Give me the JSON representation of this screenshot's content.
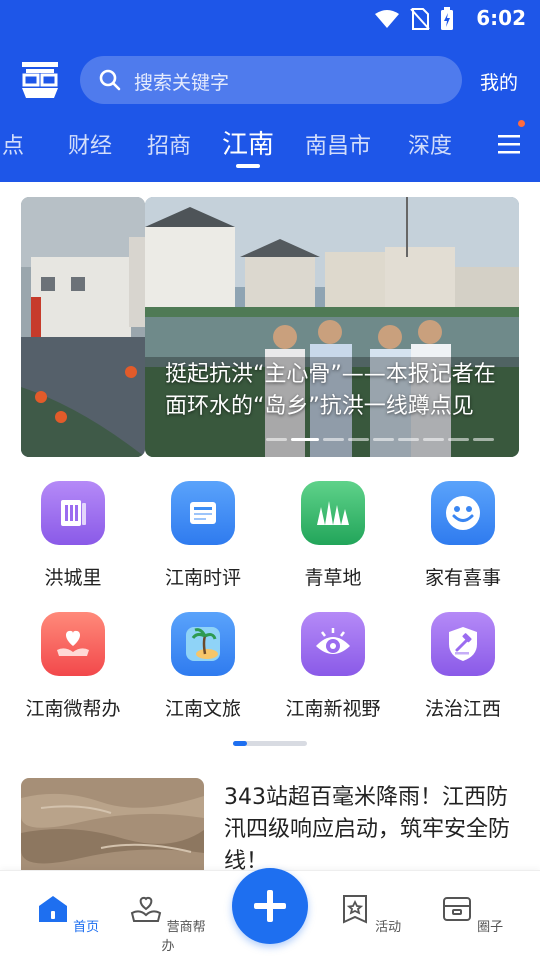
{
  "status_bar": {
    "time": "6:02"
  },
  "header": {
    "search_placeholder": "搜索关键字",
    "mine_label": "我的"
  },
  "tabs": [
    "点",
    "财经",
    "招商",
    "江南",
    "南昌市",
    "深度"
  ],
  "active_tab": "江南",
  "carousel": {
    "caption_line1": "挺起抗洪“主心骨”——本报记者在",
    "caption_line2": "面环水的“岛乡”抗洪一线蹲点见",
    "dot_count": 9,
    "active_dot": 2
  },
  "grid": [
    {
      "label": "洪城里",
      "icon": "book-icon",
      "color": "#9b6cf0"
    },
    {
      "label": "江南时评",
      "icon": "newspaper-icon",
      "color": "#3d8ef5"
    },
    {
      "label": "青草地",
      "icon": "grass-icon",
      "color": "#2fb86a"
    },
    {
      "label": "家有喜事",
      "icon": "smile-icon",
      "color": "#3a86f2"
    },
    {
      "label": "江南微帮办",
      "icon": "heart-hand-icon",
      "color": "#ff5a5a"
    },
    {
      "label": "江南文旅",
      "icon": "island-icon",
      "color": "#3d8ef5"
    },
    {
      "label": "江南新视野",
      "icon": "eye-icon",
      "color": "#9b6cf0"
    },
    {
      "label": "法治江西",
      "icon": "gavel-shield-icon",
      "color": "#9b6cf0"
    }
  ],
  "news": {
    "title": "343站超百毫米降雨！江西防汛四级响应启动，筑牢安全防线！"
  },
  "bottom_nav": [
    {
      "label": "首页",
      "icon": "home-icon",
      "active": true
    },
    {
      "label": "营商帮办",
      "icon": "handshake-icon",
      "active": false
    },
    {
      "label": "活动",
      "icon": "star-badge-icon",
      "active": false
    },
    {
      "label": "圈子",
      "icon": "shop-icon",
      "active": false
    }
  ],
  "colors": {
    "brand": "#1e56e8",
    "accent": "#1e6ff0"
  }
}
